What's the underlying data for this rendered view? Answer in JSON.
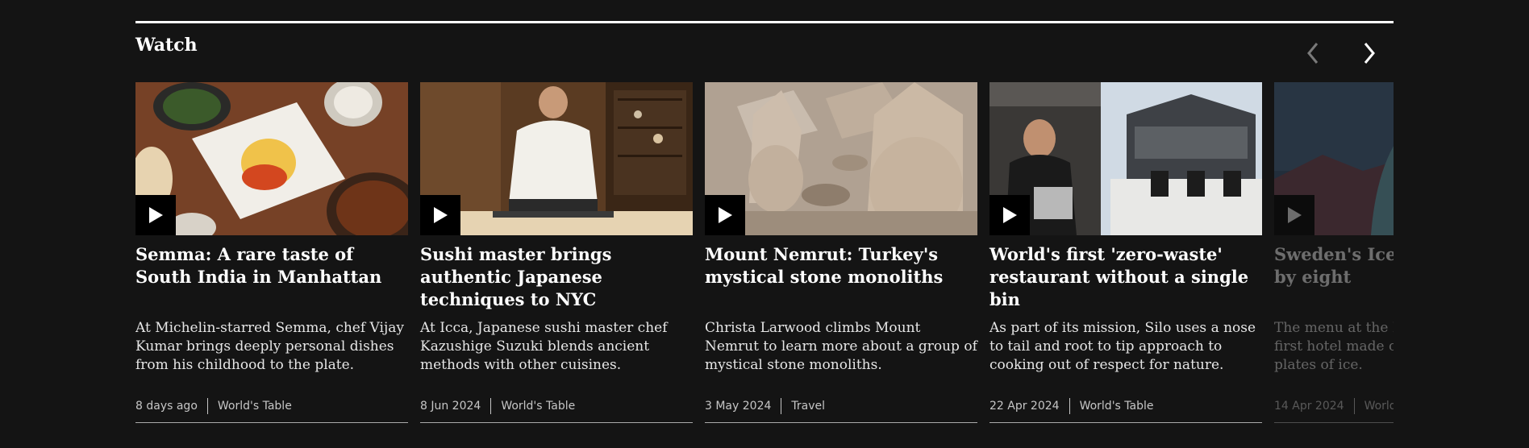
{
  "section": {
    "title": "Watch"
  },
  "nav": {
    "prev_icon": "chevron-left-icon",
    "next_icon": "chevron-right-icon"
  },
  "cards": [
    {
      "headline": "Semma: A rare taste of South India in Manhattan",
      "summary": "At Michelin-starred Semma, chef Vijay Kumar brings deeply personal dishes from his childhood to the plate.",
      "date": "8 days ago",
      "category": "World's Table"
    },
    {
      "headline": "Sushi master brings authentic Japanese techniques to NYC",
      "summary": "At Icca, Japanese sushi master chef Kazushige Suzuki blends ancient methods with other cuisines.",
      "date": "8 Jun 2024",
      "category": "World's Table"
    },
    {
      "headline": "Mount Nemrut: Turkey's mystical stone monoliths",
      "summary": "Christa Larwood climbs Mount Nemrut to learn more about a group of mystical stone monoliths.",
      "date": "3 May 2024",
      "category": "Travel"
    },
    {
      "headline": "World's first 'zero-waste' restaurant without a single bin",
      "summary": "As part of its mission, Silo uses a nose to tail and root to tip approach to cooking out of respect for nature.",
      "date": "22 Apr 2024",
      "category": "World's Table"
    },
    {
      "headline": "Sweden's Icehotel inspired by eight",
      "summary": "The menu at the Icehotel, the world's first hotel made of ice, is served on plates of ice.",
      "date": "14 Apr 2024",
      "category": "World's Table"
    }
  ]
}
